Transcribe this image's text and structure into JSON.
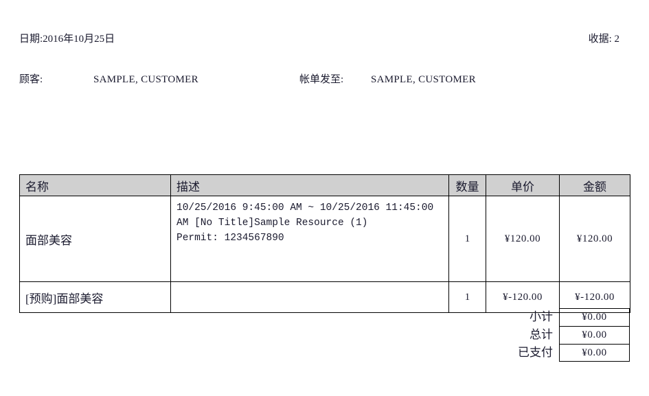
{
  "header": {
    "date_text": "日期:2016年10月25日",
    "receipt_text": "收据: 2",
    "customer_label": "顾客:",
    "customer_value": "SAMPLE, CUSTOMER",
    "bill_to_label": "帐单发至:",
    "bill_to_value": "SAMPLE, CUSTOMER"
  },
  "table": {
    "columns": [
      "名称",
      "描述",
      "数量",
      "单价",
      "金额"
    ],
    "rows": [
      {
        "name": "面部美容",
        "description": "10/25/2016 9:45:00 AM ~ 10/25/2016 11:45:00 AM [No Title]Sample Resource (1)\nPermit: 1234567890",
        "quantity": "1",
        "unit_price": "¥120.00",
        "amount": "¥120.00"
      },
      {
        "name": "[预购]面部美容",
        "description": "",
        "quantity": "1",
        "unit_price": "¥-120.00",
        "amount": "¥-120.00"
      }
    ]
  },
  "totals": [
    {
      "label": "小计",
      "value": "¥0.00"
    },
    {
      "label": "总计",
      "value": "¥0.00"
    },
    {
      "label": "已支付",
      "value": "¥0.00"
    }
  ],
  "colors": {
    "header_background": "#d0d0d0",
    "border": "#000000",
    "text": "#1a1a2e",
    "page_background": "#ffffff"
  }
}
